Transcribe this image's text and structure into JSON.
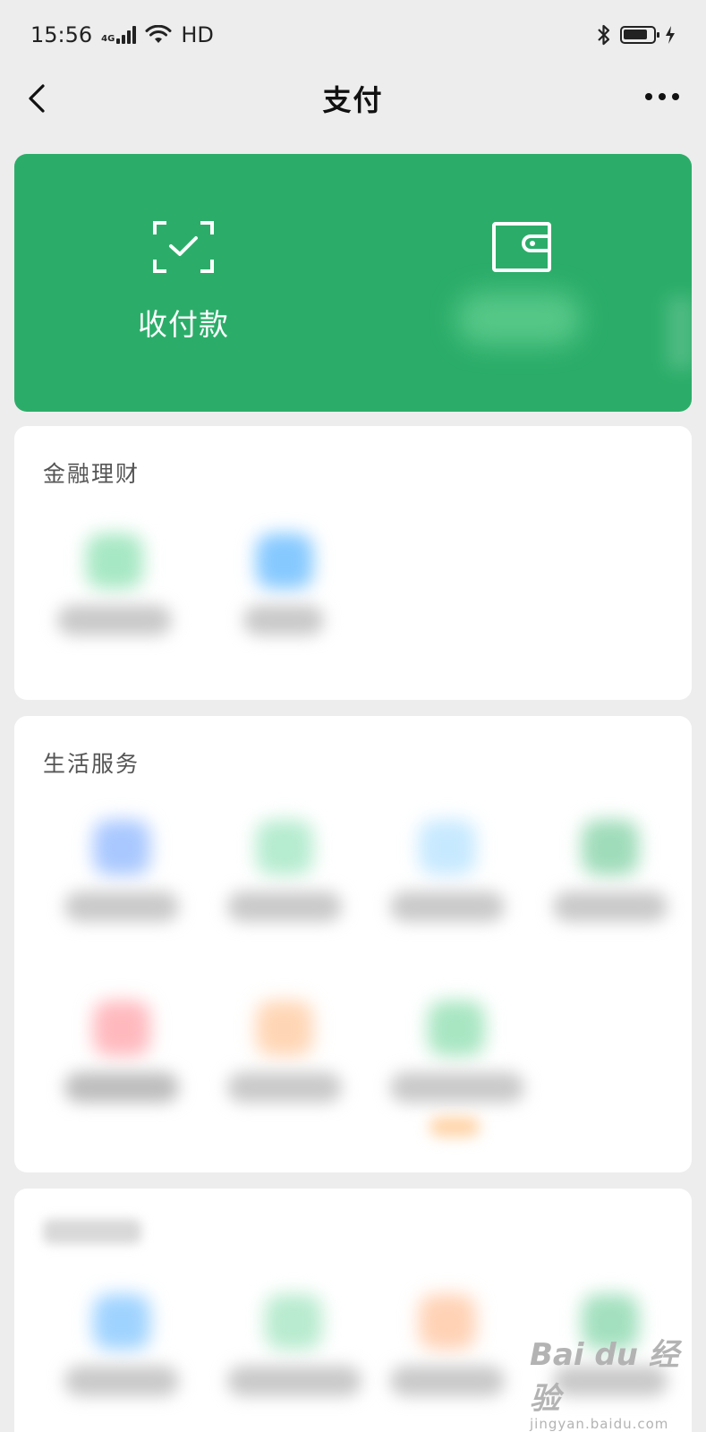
{
  "status_bar": {
    "time": "15:56",
    "network": "4G",
    "hd": "HD"
  },
  "nav": {
    "title": "支付"
  },
  "pay_card": {
    "color": "#2bad69",
    "items": [
      {
        "label": "收付款",
        "icon": "scan-check-icon"
      },
      {
        "label": "",
        "icon": "wallet-icon"
      }
    ]
  },
  "sections": [
    {
      "title": "金融理财"
    },
    {
      "title": "生活服务"
    },
    {
      "title": ""
    }
  ],
  "watermark": {
    "main": "Bai du 经验",
    "sub": "jingyan.baidu.com"
  }
}
